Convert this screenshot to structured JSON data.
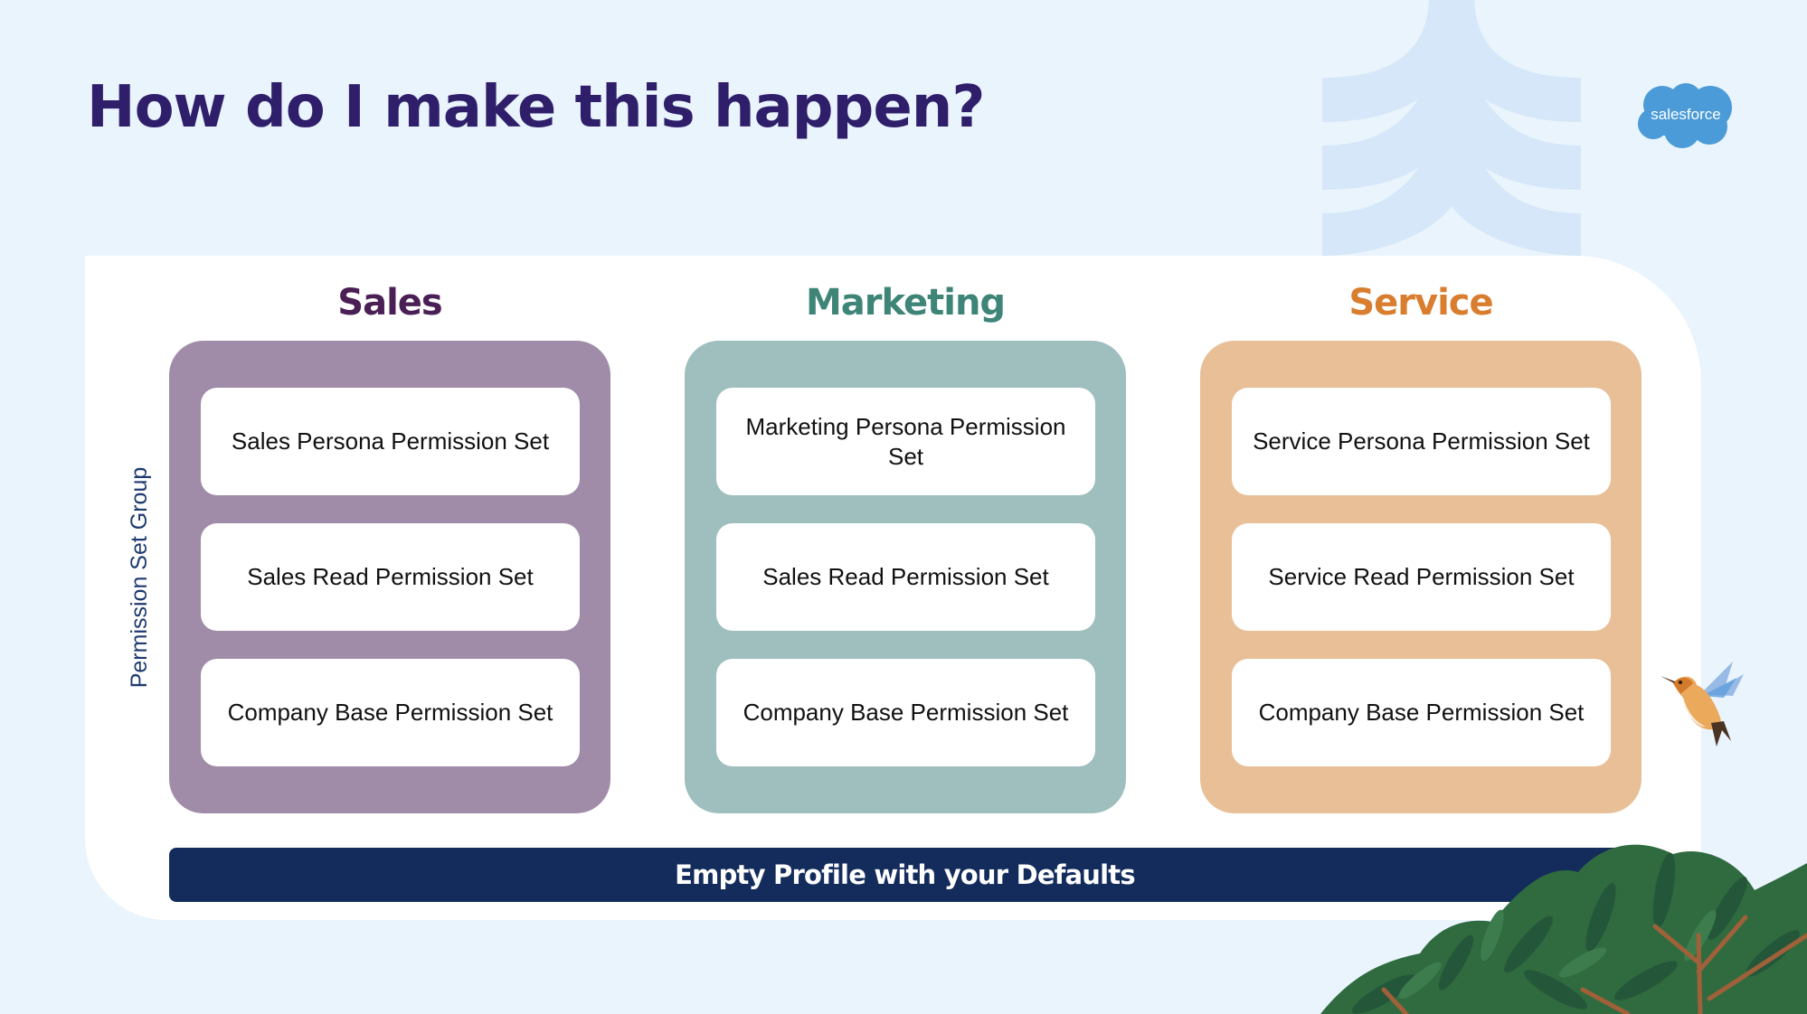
{
  "slide": {
    "title": "How do I make this happen?",
    "logo_text": "salesforce",
    "side_label": "Permission Set Group",
    "base_bar_label": "Empty Profile with your Defaults"
  },
  "columns": [
    {
      "heading": "Sales",
      "heading_color": "#4a1f55",
      "box_color": "#a08ca8",
      "cards": [
        "Sales Persona Permission Set",
        "Sales Read Permission Set",
        "Company Base Permission Set"
      ]
    },
    {
      "heading": "Marketing",
      "heading_color": "#3e8578",
      "box_color": "#9ebfbe",
      "cards": [
        "Marketing Persona Permission Set",
        "Sales Read Permission Set",
        "Company Base Permission Set"
      ]
    },
    {
      "heading": "Service",
      "heading_color": "#d97d2e",
      "box_color": "#e8bf96",
      "cards": [
        "Service Persona Permission Set",
        "Service Read Permission Set",
        "Company Base Permission Set"
      ]
    }
  ],
  "colors": {
    "background": "#eaf4fd",
    "title": "#2f1f6b",
    "base_bar": "#132c5c",
    "logo": "#4a9bd8",
    "tree_watermark": "#d5e7f8"
  },
  "icons": {
    "logo": "salesforce-cloud-logo",
    "watermark": "tree-watermark",
    "bird": "hummingbird-illustration",
    "plant": "bush-illustration"
  }
}
